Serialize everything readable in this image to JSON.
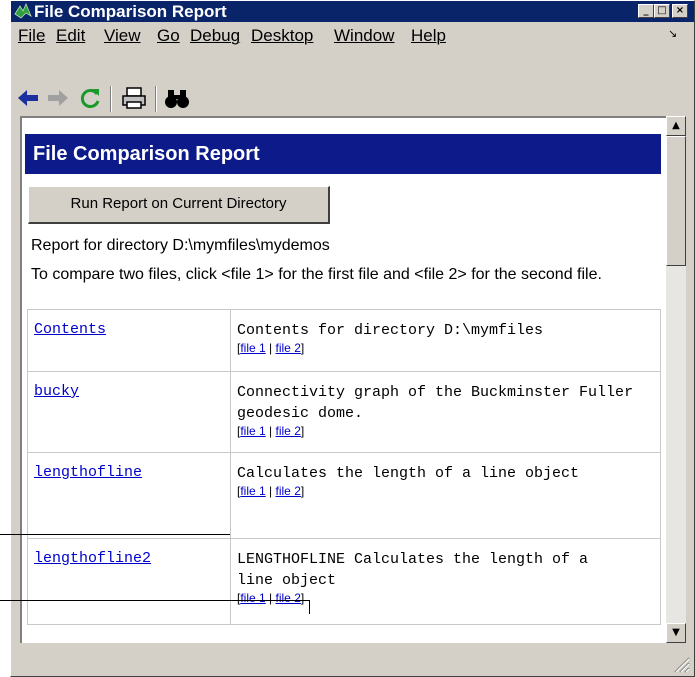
{
  "window": {
    "title": "File Comparison Report",
    "minimize_glyph": "_",
    "maximize_glyph": "□",
    "close_glyph": "×"
  },
  "menu": [
    "File",
    "Edit",
    "View",
    "Go",
    "Debug",
    "Desktop",
    "Window",
    "Help"
  ],
  "menu_overflow_glyph": "↘",
  "toolbar": {
    "icons": [
      "back-arrow-icon",
      "forward-arrow-icon",
      "refresh-icon",
      "print-icon",
      "find-binoculars-icon"
    ]
  },
  "report": {
    "header": "File Comparison Report",
    "run_button": "Run Report on Current Directory",
    "directory_line": "Report for directory D:\\mymfiles\\mydemos",
    "instructions": "To compare two files, click <file 1> for the first file and <file 2> for the second file.",
    "link_open": "[",
    "link_sep": "|",
    "link_close": "]",
    "link_file1": "file 1",
    "link_file2": "file 2",
    "rows": [
      {
        "name": "Contents",
        "description": "Contents for directory D:\\mymfiles"
      },
      {
        "name": "bucky",
        "description": "Connectivity graph of the Buckminster Fuller geodesic dome."
      },
      {
        "name": "lengthofline",
        "description": "Calculates the length of a line object"
      },
      {
        "name": "lengthofline2",
        "description": "LENGTHOFLINE Calculates the length of a line object"
      }
    ]
  },
  "colors": {
    "titlebar": "#0a246a",
    "header_band": "#0c1a8a",
    "link": "#0000cc",
    "window_face": "#d4d0c8"
  }
}
